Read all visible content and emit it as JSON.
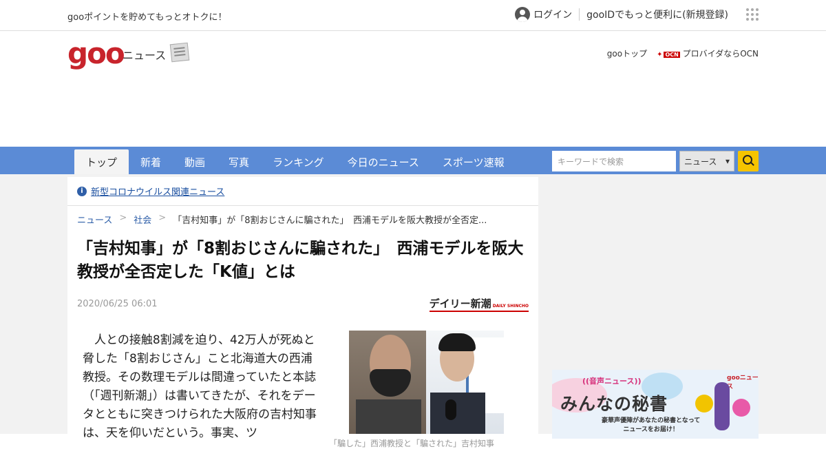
{
  "topbar": {
    "promo": "gooポイントを貯めてもっとオトクに！",
    "login": "ログイン",
    "register": "gooIDでもっと便利に(新規登録)"
  },
  "header": {
    "logo": "goo",
    "section": "ニュース",
    "goo_top": "gooトップ",
    "ocn_text": "プロバイダならOCN"
  },
  "nav": {
    "tabs": [
      "トップ",
      "新着",
      "動画",
      "写真",
      "ランキング",
      "今日のニュース",
      "スポーツ速報"
    ],
    "search_placeholder": "キーワードで検索",
    "search_scope": "ニュース"
  },
  "notice": {
    "link": "新型コロナウイルス関連ニュース"
  },
  "breadcrumb": {
    "items": [
      "ニュース",
      "社会"
    ],
    "current": "「吉村知事」が「8割おじさんに騙された」　西浦モデルを阪大教授が全否定..."
  },
  "article": {
    "title": "「吉村知事」が「8割おじさんに騙された」　西浦モデルを阪大教授が全否定した「K値」とは",
    "date": "2020/06/25 06:01",
    "source": "デイリー新潮",
    "source_en": "DAILY SHINCHO",
    "body": "　人との接触8割減を迫り、42万人が死ぬと脅した「8割おじさん」こと北海道大の西浦教授。その数理モデルは間違っていたと本誌（「週刊新潮」）は書いてきたが、それをデータとともに突きつけられた大阪府の吉村知事は、天を仰いだという。事実、ツ",
    "caption": "「騙した」西浦教授と「騙された」吉村知事"
  },
  "ad": {
    "voice": "((音声ニュース))",
    "brand": "gooニュース",
    "headline": "みんなの秘書",
    "sub1": "豪華声優陣があなたの秘書となって",
    "sub2": "ニュースをお届け！"
  },
  "colors": {
    "brand_red": "#c8242c",
    "nav_blue": "#5b8bd6",
    "search_yellow": "#f5c400"
  }
}
